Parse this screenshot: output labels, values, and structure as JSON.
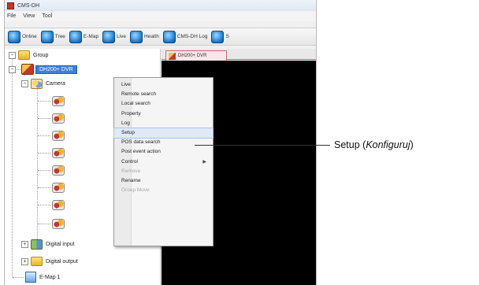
{
  "window": {
    "title": "CMS-DH"
  },
  "menubar": {
    "items": [
      "File",
      "View",
      "Tool"
    ]
  },
  "toolbar": {
    "buttons": [
      {
        "label": "Online",
        "icon": "online-icon"
      },
      {
        "label": "Tree",
        "icon": "tree-icon"
      },
      {
        "label": "E-Map",
        "icon": "emap-icon"
      },
      {
        "label": "Live",
        "icon": "live-icon"
      },
      {
        "label": "Health",
        "icon": "health-icon"
      },
      {
        "label": "CMS-DH Log",
        "icon": "log-icon"
      },
      {
        "label": "S",
        "icon": "search-icon"
      }
    ]
  },
  "tree": {
    "root": "Group",
    "dvr": "DH200+ DVR",
    "cameras_folder": "Camera",
    "digital_input": "Digital input",
    "digital_output": "Digital output",
    "emap": "E-Map 1"
  },
  "view": {
    "tab_label": "DH200+ DVR"
  },
  "context_menu": {
    "items": [
      {
        "label": "Live",
        "enabled": true
      },
      {
        "label": "Remote search",
        "enabled": true
      },
      {
        "label": "Local search",
        "enabled": true
      },
      {
        "label": "Property",
        "enabled": true
      },
      {
        "label": "Log",
        "enabled": true
      },
      {
        "label": "Setup",
        "enabled": true,
        "highlighted": true
      },
      {
        "label": "POS data search",
        "enabled": true
      },
      {
        "label": "Post event action",
        "enabled": true
      },
      {
        "label": "Control",
        "enabled": true,
        "has_submenu": true
      },
      {
        "label": "Remove",
        "enabled": false
      },
      {
        "label": "Rename",
        "enabled": true
      },
      {
        "label": "Group Move",
        "enabled": false
      }
    ]
  },
  "callout": {
    "prefix": "Setup (",
    "italic": "Konfiguruj",
    "suffix": ")"
  },
  "colors": {
    "selection": "#3b7fdc",
    "video_bg": "#000000",
    "tab_border": "#c46b7a"
  }
}
